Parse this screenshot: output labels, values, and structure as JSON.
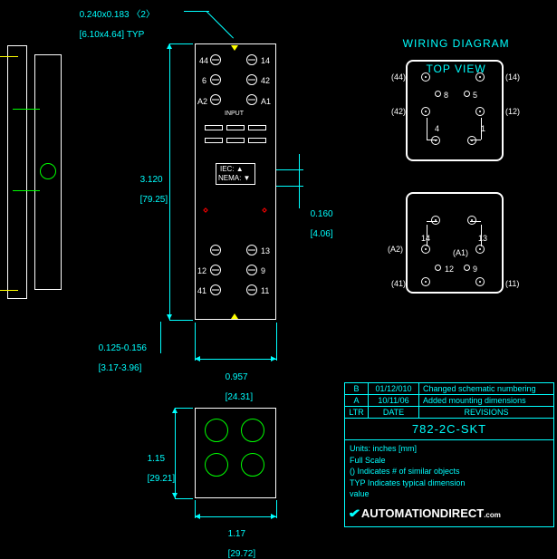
{
  "dimensions": {
    "top_hole": {
      "line1": "0.240x0.183 〈2〉",
      "line2": "[6.10x4.64] TYP"
    },
    "height_main": {
      "line1": "3.120",
      "line2": "[79.25]"
    },
    "side_step": {
      "line1": "0.160",
      "line2": "[4.06]"
    },
    "base_slot": {
      "line1": "0.125-0.156",
      "line2": "[3.17-3.96]"
    },
    "width": {
      "line1": "0.957",
      "line2": "[24.31]"
    },
    "height_bottom": {
      "line1": "1.15",
      "line2": "[29.21]"
    },
    "width_bottom": {
      "line1": "1.17",
      "line2": "[29.72]"
    }
  },
  "component_text": {
    "row_a2": "A2",
    "row_a1": "A1",
    "input": "INPUT",
    "iec": "IEC: ▲",
    "nema": "NEMA: ▼"
  },
  "wiring": {
    "title_line1": "WIRING DIAGRAM",
    "title_line2": "TOP VIEW",
    "top_pins": {
      "p44": "(44)",
      "p14": "(14)",
      "p8": "8",
      "p5": "5",
      "p42": "(42)",
      "p12": "(12)",
      "p4": "4",
      "p1": "1"
    },
    "bot_pins": {
      "p14": "14",
      "p13": "13",
      "pA2": "(A2)",
      "pA1": "(A1)",
      "p12": "12",
      "p9": "9",
      "p41": "(41)",
      "p11": "(11)"
    }
  },
  "main_pins": {
    "p44": "44",
    "p14": "14",
    "p6": "6",
    "p42_t": "42",
    "pA2": "A2",
    "pA1": "A1",
    "p13": "13",
    "p12b": "12",
    "p9": "9",
    "p41": "41",
    "p11": "11"
  },
  "titleblock": {
    "rows": [
      {
        "ltr": "B",
        "date": "01/12/010",
        "rev": "Changed schematic numbering"
      },
      {
        "ltr": "A",
        "date": "10/11/06",
        "rev": "Added mounting dimensions"
      },
      {
        "ltr": "LTR",
        "date": "DATE",
        "rev": "REVISIONS"
      }
    ],
    "part": "782-2C-SKT",
    "notes_line1": "Units: inches [mm]",
    "notes_line2": "Full Scale",
    "notes_line3": "() Indicates # of similar objects",
    "notes_line4": "TYP Indicates typical dimension",
    "notes_line5": "    value",
    "logo_text": "AUTOMATIONDIRECT",
    "logo_suffix": ".com"
  }
}
